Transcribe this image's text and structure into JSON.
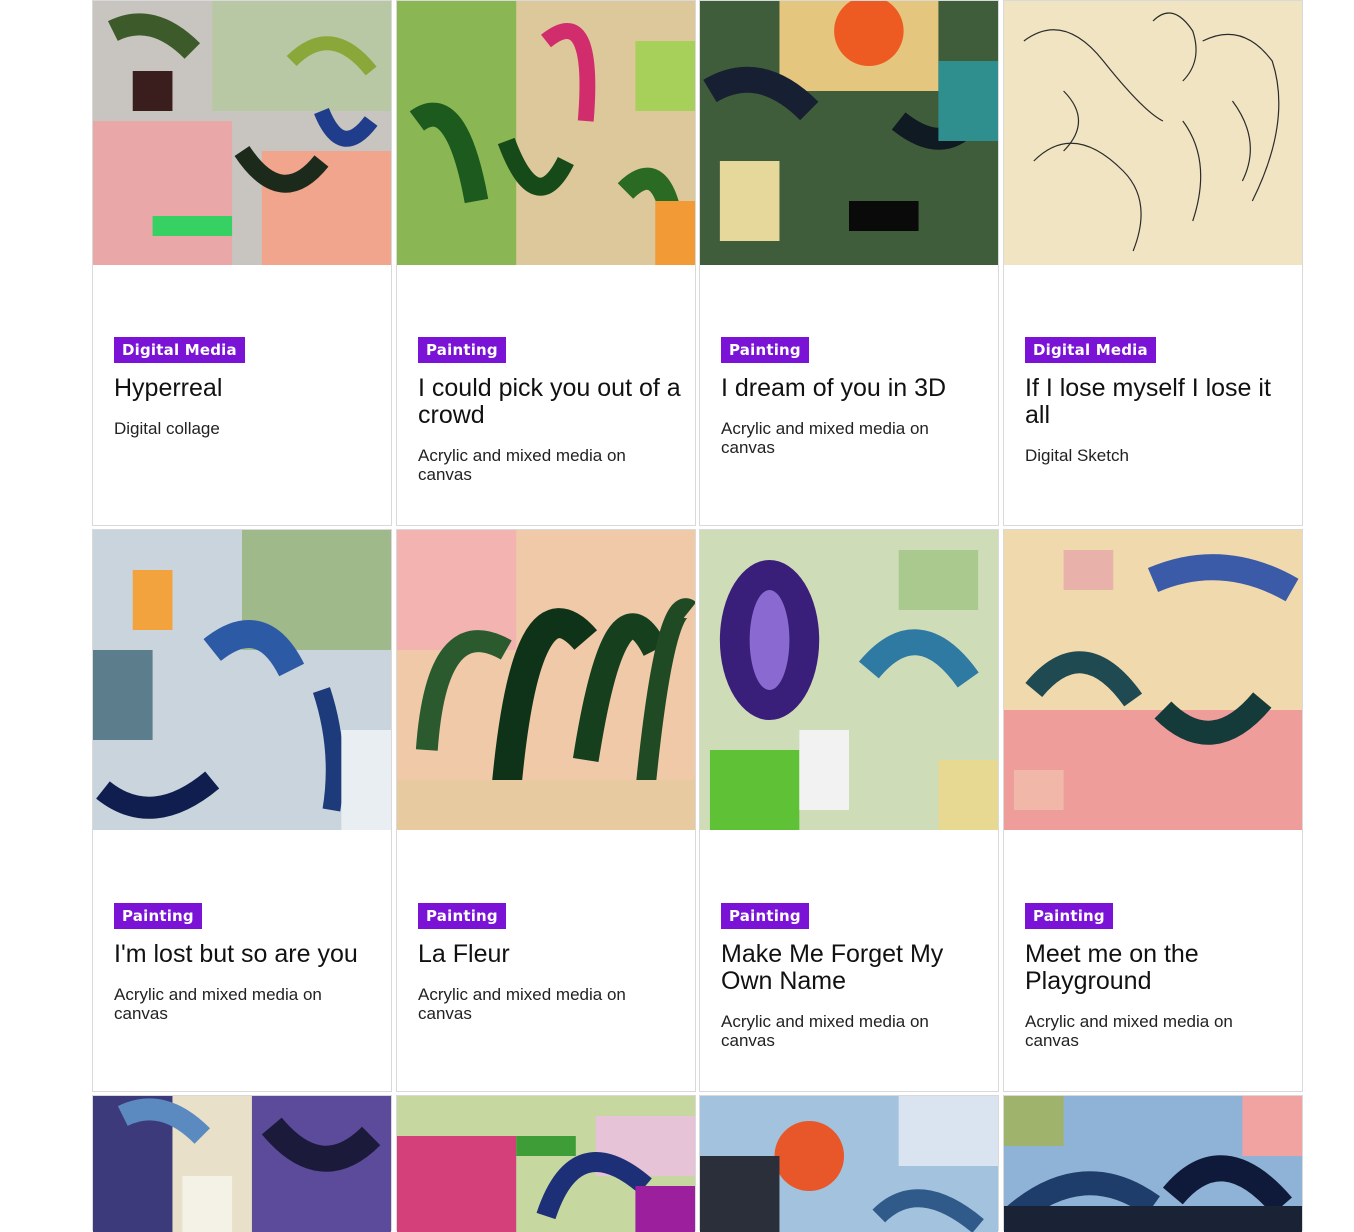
{
  "gallery": {
    "items": [
      {
        "category": "Digital Media",
        "title": "Hyperreal",
        "medium": "Digital collage"
      },
      {
        "category": "Painting",
        "title": "I could pick you out of a crowd",
        "medium": "Acrylic and mixed media on canvas"
      },
      {
        "category": "Painting",
        "title": "I dream of you in 3D",
        "medium": "Acrylic and mixed media on canvas"
      },
      {
        "category": "Digital Media",
        "title": "If I lose myself I lose it all",
        "medium": "Digital Sketch"
      },
      {
        "category": "Painting",
        "title": "I'm lost but so are you",
        "medium": "Acrylic and mixed media on canvas"
      },
      {
        "category": "Painting",
        "title": "La Fleur",
        "medium": "Acrylic and mixed media on canvas"
      },
      {
        "category": "Painting",
        "title": "Make Me Forget My Own Name",
        "medium": "Acrylic and mixed media on canvas"
      },
      {
        "category": "Painting",
        "title": "Meet me on the Playground",
        "medium": "Acrylic and mixed media on canvas"
      }
    ]
  },
  "colors": {
    "badge_background": "#7a13d6",
    "badge_text": "#ffffff",
    "card_border": "#d9d9d9"
  }
}
